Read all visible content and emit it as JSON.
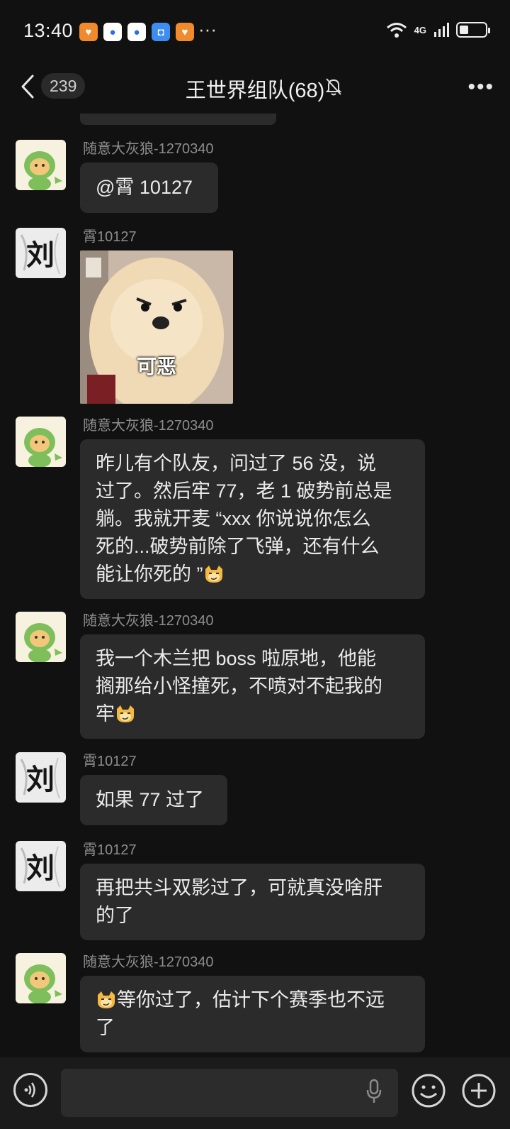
{
  "status_bar": {
    "time": "13:40",
    "network": "4G",
    "battery_level": 0.35,
    "more_label": "···"
  },
  "header": {
    "unread_count": "239",
    "title": "王世界组队(68)"
  },
  "messages": [
    {
      "sender": "随意大灰狼-1270340",
      "text": "@霄 10127",
      "avatar": "green-dino-dog-avatar"
    },
    {
      "sender": "霄10127",
      "sticker_caption": "可恶",
      "avatar": "calligraphy-liu-avatar"
    },
    {
      "sender": "随意大灰狼-1270340",
      "text_lines": [
        "昨儿有个队友，问过了 56 没，说",
        "过了。然后牢 77，老 1 破势前总是",
        "躺。我就开麦 “xxx 你说说你怎么",
        "死的...破势前除了飞弹，还有什么",
        "能让你死的 ”"
      ],
      "avatar": "green-dino-dog-avatar"
    },
    {
      "sender": "随意大灰狼-1270340",
      "text_lines": [
        "我一个木兰把 boss 啦原地，他能",
        "搁那给小怪撞死，不喷对不起我的",
        "牢"
      ],
      "avatar": "green-dino-dog-avatar"
    },
    {
      "sender": "霄10127",
      "text": "如果 77 过了",
      "avatar": "calligraphy-liu-avatar"
    },
    {
      "sender": "霄10127",
      "text_lines": [
        "再把共斗双影过了，可就真没啥肝",
        "的了"
      ],
      "avatar": "calligraphy-liu-avatar"
    },
    {
      "sender": "随意大灰狼-1270340",
      "text_lines": [
        "等你过了，估计下个赛季也不远",
        "了"
      ],
      "avatar": "green-dino-dog-avatar"
    }
  ],
  "avatar_text": {
    "liu": "刘"
  },
  "input": {
    "placeholder": ""
  },
  "colors": {
    "background": "#111111",
    "bubble": "#2b2b2b",
    "sender": "#8d8d8d"
  }
}
